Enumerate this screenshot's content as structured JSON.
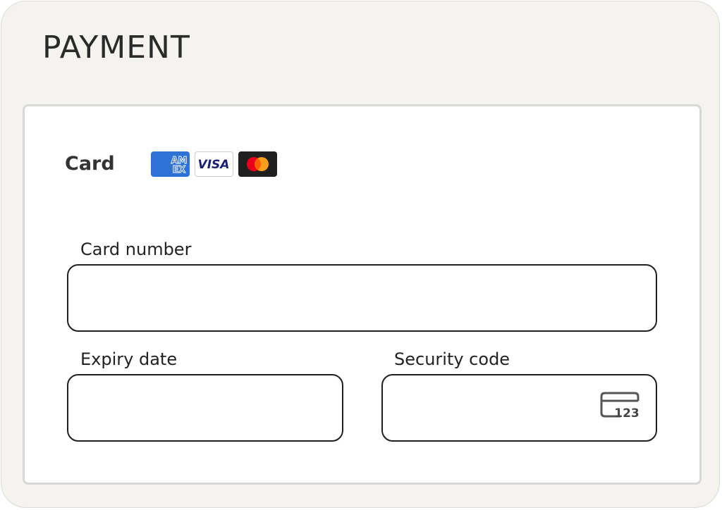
{
  "header": {
    "title": "PAYMENT"
  },
  "payment_method": {
    "label": "Card",
    "brands": [
      {
        "name": "American Express",
        "text": "AM EX",
        "icon": "amex-logo",
        "color": "#2f72d6"
      },
      {
        "name": "Visa",
        "text": "VISA",
        "icon": "visa-logo",
        "color": "#1a1f71"
      },
      {
        "name": "Mastercard",
        "icon": "mastercard-logo",
        "color": "#1f1f1f"
      }
    ]
  },
  "fields": {
    "card_number": {
      "label": "Card number",
      "value": "",
      "placeholder": ""
    },
    "expiry_date": {
      "label": "Expiry date",
      "value": "",
      "placeholder": ""
    },
    "security_code": {
      "label": "Security code",
      "value": "",
      "placeholder": "",
      "icon": "card-cvc-icon",
      "icon_text": "123"
    }
  }
}
